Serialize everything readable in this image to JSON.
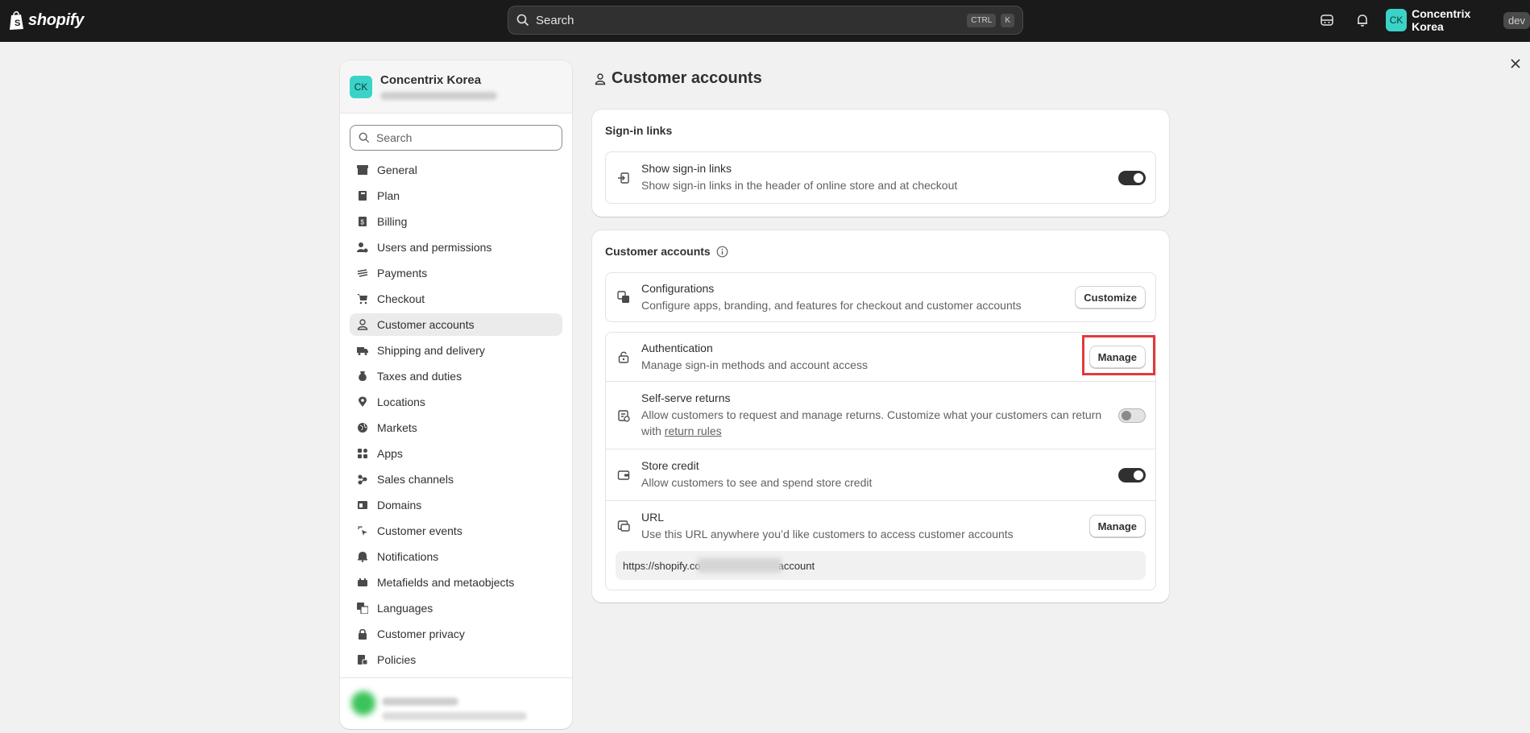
{
  "topbar": {
    "logo_text": "shopify",
    "search_placeholder": "Search",
    "shortcut_keys": [
      "CTRL",
      "K"
    ],
    "store_initials": "CK",
    "store_name": "Concentrix Korea",
    "badge": "dev"
  },
  "sidebar": {
    "store_initials": "CK",
    "store_name": "Concentrix Korea",
    "search_placeholder": "Search",
    "items": [
      {
        "label": "General",
        "icon": "store-icon"
      },
      {
        "label": "Plan",
        "icon": "plan-icon"
      },
      {
        "label": "Billing",
        "icon": "billing-icon"
      },
      {
        "label": "Users and permissions",
        "icon": "users-icon"
      },
      {
        "label": "Payments",
        "icon": "payments-icon"
      },
      {
        "label": "Checkout",
        "icon": "cart-icon"
      },
      {
        "label": "Customer accounts",
        "icon": "person-icon",
        "active": true
      },
      {
        "label": "Shipping and delivery",
        "icon": "truck-icon"
      },
      {
        "label": "Taxes and duties",
        "icon": "tax-icon"
      },
      {
        "label": "Locations",
        "icon": "location-icon"
      },
      {
        "label": "Markets",
        "icon": "globe-icon"
      },
      {
        "label": "Apps",
        "icon": "apps-icon"
      },
      {
        "label": "Sales channels",
        "icon": "channels-icon"
      },
      {
        "label": "Domains",
        "icon": "domains-icon"
      },
      {
        "label": "Customer events",
        "icon": "events-icon"
      },
      {
        "label": "Notifications",
        "icon": "bell-icon"
      },
      {
        "label": "Metafields and metaobjects",
        "icon": "metafields-icon"
      },
      {
        "label": "Languages",
        "icon": "language-icon"
      },
      {
        "label": "Customer privacy",
        "icon": "lock-icon"
      },
      {
        "label": "Policies",
        "icon": "policies-icon"
      }
    ]
  },
  "main": {
    "page_title": "Customer accounts",
    "signin_card": {
      "title": "Sign-in links",
      "row": {
        "title": "Show sign-in links",
        "description": "Show sign-in links in the header of online store and at checkout",
        "enabled": true
      }
    },
    "accounts_card": {
      "title": "Customer accounts",
      "configurations": {
        "title": "Configurations",
        "description": "Configure apps, branding, and features for checkout and customer accounts",
        "button": "Customize"
      },
      "authentication": {
        "title": "Authentication",
        "description": "Manage sign-in methods and account access",
        "button": "Manage"
      },
      "returns": {
        "title": "Self-serve returns",
        "description": "Allow customers to request and manage returns. Customize what your customers can return with",
        "link": "return rules",
        "enabled": false
      },
      "store_credit": {
        "title": "Store credit",
        "description": "Allow customers to see and spend store credit",
        "enabled": true
      },
      "url": {
        "title": "URL",
        "description": "Use this URL anywhere you’d like customers to access customer accounts",
        "button": "Manage",
        "value_prefix": "https://shopify.co",
        "value_suffix": "account"
      }
    }
  },
  "colors": {
    "topbar": "#1a1a1a",
    "avatar": "#3bd3c8",
    "highlight": "#e03a3e",
    "background": "#f1f1f1"
  }
}
